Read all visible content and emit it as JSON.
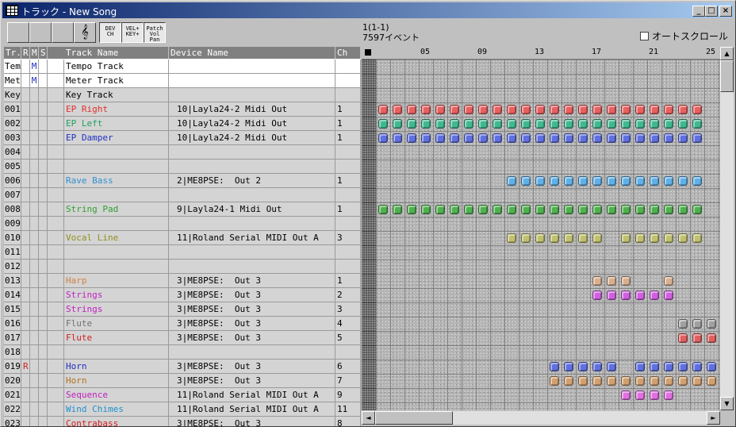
{
  "window": {
    "title": "トラック - New Song",
    "min": "_",
    "max": "□",
    "close": "×"
  },
  "toolbar": {
    "buttons": [
      {
        "label": "",
        "name": "blank-button"
      },
      {
        "label": "",
        "name": "piano-roll-button"
      },
      {
        "label": "",
        "name": "event-list-button"
      },
      {
        "label": "𝄞",
        "name": "score-button"
      },
      {
        "label": "DEV\nCH",
        "name": "dev-ch-button"
      },
      {
        "label": "VEL+\nKEY+",
        "name": "vel-key-button"
      },
      {
        "label": "Patch\nVol\nPan",
        "name": "patch-vol-pan-button"
      }
    ],
    "status_line1": "1(1-1)",
    "status_line2": "7597イベント",
    "autoscroll_label": "オートスクロール"
  },
  "table": {
    "headers": [
      "Tr.",
      "R",
      "M",
      "S",
      "Track Name",
      "Device Name",
      "Ch"
    ],
    "rows": [
      {
        "tr": "Tem",
        "r": "",
        "m": "M",
        "s": "",
        "name": "Tempo Track",
        "device": "",
        "ch": "",
        "color": "#000000"
      },
      {
        "tr": "Met",
        "r": "",
        "m": "M",
        "s": "",
        "name": "Meter Track",
        "device": "",
        "ch": "",
        "color": "#000000"
      },
      {
        "tr": "Key",
        "r": "",
        "m": "",
        "s": "",
        "name": "Key Track",
        "device": "",
        "ch": "",
        "color": "#000000"
      },
      {
        "tr": "001",
        "r": "",
        "m": "",
        "s": "",
        "name": "EP Right",
        "device": "10|Layla24-2 Midi Out",
        "ch": "1",
        "color": "#e03030"
      },
      {
        "tr": "002",
        "r": "",
        "m": "",
        "s": "",
        "name": "EP Left",
        "device": "10|Layla24-2 Midi Out",
        "ch": "1",
        "color": "#20a060"
      },
      {
        "tr": "003",
        "r": "",
        "m": "",
        "s": "",
        "name": "EP Damper",
        "device": "10|Layla24-2 Midi Out",
        "ch": "1",
        "color": "#2030c0"
      },
      {
        "tr": "004",
        "r": "",
        "m": "",
        "s": "",
        "name": "",
        "device": "",
        "ch": "",
        "color": "#000000"
      },
      {
        "tr": "005",
        "r": "",
        "m": "",
        "s": "",
        "name": "",
        "device": "",
        "ch": "",
        "color": "#000000"
      },
      {
        "tr": "006",
        "r": "",
        "m": "",
        "s": "",
        "name": "Rave Bass",
        "device": "2|ME8PSE:  Out 2",
        "ch": "1",
        "color": "#3090d0"
      },
      {
        "tr": "007",
        "r": "",
        "m": "",
        "s": "",
        "name": "",
        "device": "",
        "ch": "",
        "color": "#000000"
      },
      {
        "tr": "008",
        "r": "",
        "m": "",
        "s": "",
        "name": "String Pad",
        "device": "9|Layla24-1 Midi Out",
        "ch": "1",
        "color": "#30a030"
      },
      {
        "tr": "009",
        "r": "",
        "m": "",
        "s": "",
        "name": "",
        "device": "",
        "ch": "",
        "color": "#000000"
      },
      {
        "tr": "010",
        "r": "",
        "m": "",
        "s": "",
        "name": "Vocal Line",
        "device": "11|Roland Serial MIDI Out A",
        "ch": "3",
        "color": "#909020"
      },
      {
        "tr": "011",
        "r": "",
        "m": "",
        "s": "",
        "name": "",
        "device": "",
        "ch": "",
        "color": "#000000"
      },
      {
        "tr": "012",
        "r": "",
        "m": "",
        "s": "",
        "name": "",
        "device": "",
        "ch": "",
        "color": "#000000"
      },
      {
        "tr": "013",
        "r": "",
        "m": "",
        "s": "",
        "name": "Harp",
        "device": "3|ME8PSE:  Out 3",
        "ch": "1",
        "color": "#d08040"
      },
      {
        "tr": "014",
        "r": "",
        "m": "",
        "s": "",
        "name": "Strings",
        "device": "3|ME8PSE:  Out 3",
        "ch": "2",
        "color": "#c020c0"
      },
      {
        "tr": "015",
        "r": "",
        "m": "",
        "s": "",
        "name": "Strings",
        "device": "3|ME8PSE:  Out 3",
        "ch": "3",
        "color": "#c020c0"
      },
      {
        "tr": "016",
        "r": "",
        "m": "",
        "s": "",
        "name": "Flute",
        "device": "3|ME8PSE:  Out 3",
        "ch": "4",
        "color": "#707070"
      },
      {
        "tr": "017",
        "r": "",
        "m": "",
        "s": "",
        "name": "Flute",
        "device": "3|ME8PSE:  Out 3",
        "ch": "5",
        "color": "#d02020"
      },
      {
        "tr": "018",
        "r": "",
        "m": "",
        "s": "",
        "name": "",
        "device": "",
        "ch": "",
        "color": "#000000"
      },
      {
        "tr": "019",
        "r": "R",
        "m": "",
        "s": "",
        "name": "Horn",
        "device": "3|ME8PSE:  Out 3",
        "ch": "6",
        "color": "#2030c0"
      },
      {
        "tr": "020",
        "r": "",
        "m": "",
        "s": "",
        "name": "Horn",
        "device": "3|ME8PSE:  Out 3",
        "ch": "7",
        "color": "#b07020"
      },
      {
        "tr": "021",
        "r": "",
        "m": "",
        "s": "",
        "name": "Sequence",
        "device": "11|Roland Serial MIDI Out A",
        "ch": "9",
        "color": "#c020c0"
      },
      {
        "tr": "022",
        "r": "",
        "m": "",
        "s": "",
        "name": "Wind Chimes",
        "device": "11|Roland Serial MIDI Out A",
        "ch": "11",
        "color": "#2090d0"
      },
      {
        "tr": "023",
        "r": "",
        "m": "",
        "s": "",
        "name": "Contrabass",
        "device": "3|ME8PSE:  Out 3",
        "ch": "8",
        "color": "#d02020"
      }
    ]
  },
  "ruler": {
    "labels": [
      "05",
      "09",
      "13",
      "17",
      "21",
      "25"
    ],
    "label_measures": [
      5,
      9,
      13,
      17,
      21,
      25
    ]
  },
  "blocks": [
    {
      "row": 3,
      "color": "#e86060",
      "measures": [
        2,
        3,
        4,
        5,
        6,
        7,
        8,
        9,
        10,
        11,
        12,
        13,
        14,
        15,
        16,
        17,
        18,
        19,
        20,
        21,
        22,
        23,
        24
      ]
    },
    {
      "row": 4,
      "color": "#40b890",
      "measures": [
        2,
        3,
        4,
        5,
        6,
        7,
        8,
        9,
        10,
        11,
        12,
        13,
        14,
        15,
        16,
        17,
        18,
        19,
        20,
        21,
        22,
        23,
        24
      ]
    },
    {
      "row": 5,
      "color": "#6070e0",
      "measures": [
        2,
        3,
        4,
        5,
        6,
        7,
        8,
        9,
        10,
        11,
        12,
        13,
        14,
        15,
        16,
        17,
        18,
        19,
        20,
        21,
        22,
        23,
        24
      ]
    },
    {
      "row": 8,
      "color": "#60b0e8",
      "measures": [
        11,
        12,
        13,
        14,
        15,
        16,
        17,
        18,
        19,
        20,
        21,
        22,
        23,
        24
      ]
    },
    {
      "row": 10,
      "color": "#50b050",
      "measures": [
        2,
        3,
        4,
        5,
        6,
        7,
        8,
        9,
        10,
        11,
        12,
        13,
        14,
        15,
        16,
        17,
        18,
        19,
        20,
        21,
        22,
        23,
        24
      ]
    },
    {
      "row": 12,
      "color": "#c0c070",
      "measures": [
        11,
        12,
        13,
        14,
        15,
        16,
        17,
        19,
        20,
        21,
        22,
        23,
        24
      ]
    },
    {
      "row": 15,
      "color": "#d8b090",
      "measures": [
        17,
        18,
        19,
        22
      ]
    },
    {
      "row": 16,
      "color": "#d060e0",
      "measures": [
        17,
        18,
        19,
        20,
        21,
        22
      ]
    },
    {
      "row": 18,
      "color": "#a0a0a0",
      "measures": [
        23,
        24,
        25
      ]
    },
    {
      "row": 19,
      "color": "#e06060",
      "measures": [
        23,
        24,
        25
      ]
    },
    {
      "row": 21,
      "color": "#6070e0",
      "measures": [
        14,
        15,
        16,
        17,
        18,
        20,
        21,
        22,
        23,
        24,
        25
      ]
    },
    {
      "row": 22,
      "color": "#d0a070",
      "measures": [
        14,
        15,
        16,
        17,
        18,
        19,
        20,
        21,
        22,
        23,
        24,
        25
      ]
    },
    {
      "row": 23,
      "color": "#e070e0",
      "measures": [
        19,
        20,
        21,
        22
      ]
    }
  ],
  "scroll": {
    "up": "▲",
    "down": "▼",
    "left": "◄",
    "right": "►"
  }
}
